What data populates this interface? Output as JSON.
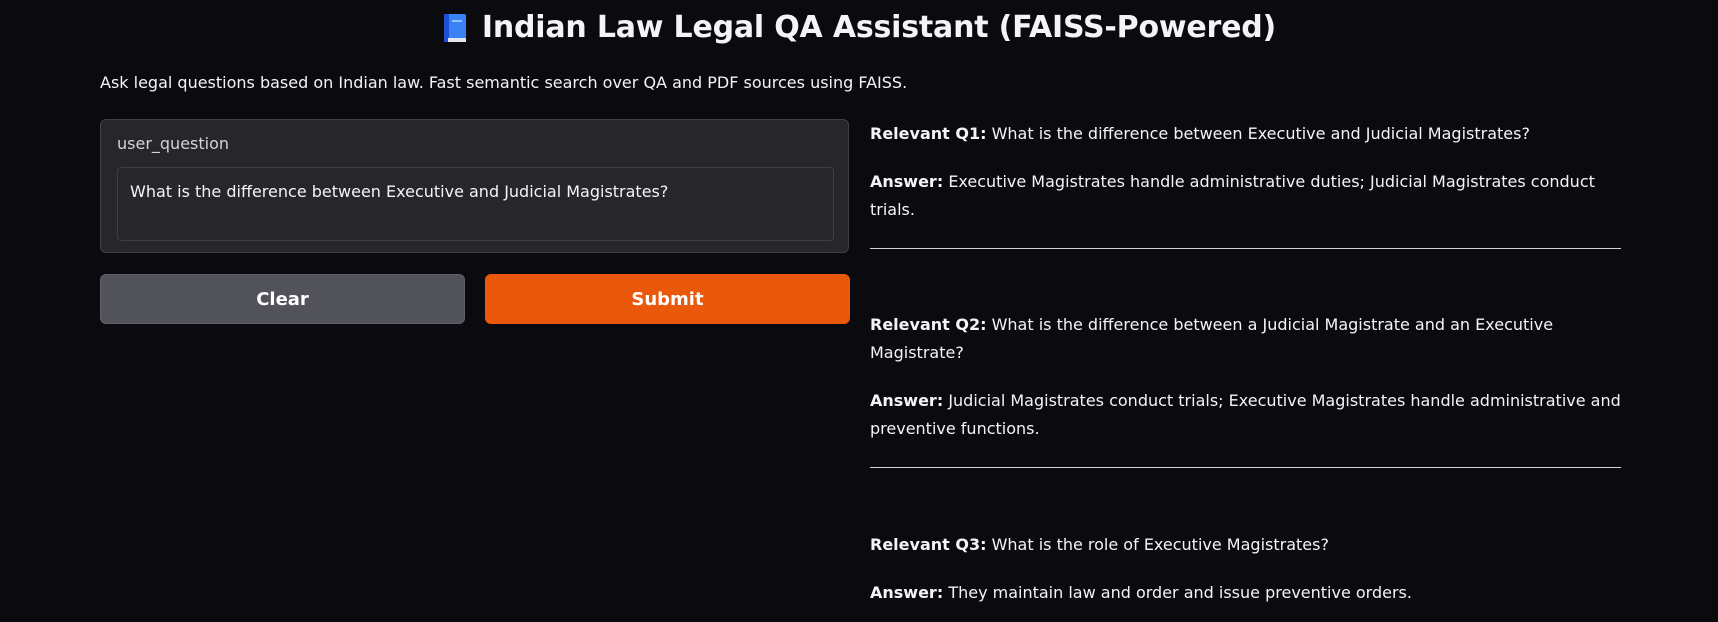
{
  "header": {
    "icon": "blue-book-icon",
    "title": "Indian Law Legal QA Assistant (FAISS-Powered)"
  },
  "description": "Ask legal questions based on Indian law. Fast semantic search over QA and PDF sources using FAISS.",
  "input": {
    "label": "user_question",
    "value": "What is the difference between Executive and Judicial Magistrates?"
  },
  "buttons": {
    "clear_label": "Clear",
    "submit_label": "Submit"
  },
  "colors": {
    "background": "#0b0b0f",
    "submit": "#ea580c",
    "clear": "#52525b"
  },
  "results": [
    {
      "q_label": "Relevant Q1:",
      "question": "What is the difference between Executive and Judicial Magistrates?",
      "a_label": "Answer:",
      "answer": "Executive Magistrates handle administrative duties; Judicial Magistrates conduct trials."
    },
    {
      "q_label": "Relevant Q2:",
      "question": "What is the difference between a Judicial Magistrate and an Executive Magistrate?",
      "a_label": "Answer:",
      "answer": "Judicial Magistrates conduct trials; Executive Magistrates handle administrative and preventive functions."
    },
    {
      "q_label": "Relevant Q3:",
      "question": "What is the role of Executive Magistrates?",
      "a_label": "Answer:",
      "answer": "They maintain law and order and issue preventive orders."
    }
  ]
}
